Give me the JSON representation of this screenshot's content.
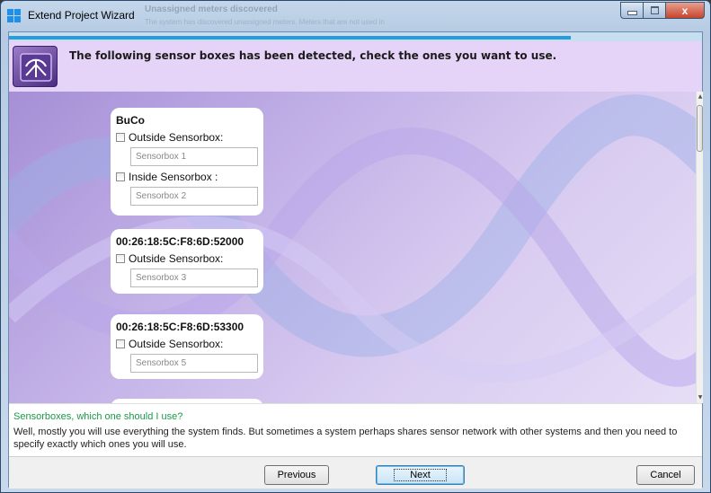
{
  "window": {
    "title": "Extend Project Wizard",
    "ghost_title": "Unassigned meters discovered",
    "ghost_subtitle": "The system has discovered unassigned meters. Meters that are not used in",
    "close_glyph": "x"
  },
  "progress": {
    "fraction": 0.81
  },
  "header": {
    "text": "The following sensor boxes has been detected, check the ones you want to use."
  },
  "devices": [
    {
      "name": "BuCo",
      "sensors": [
        {
          "label": "Outside Sensorbox:",
          "value": "Sensorbox 1",
          "checked": false
        },
        {
          "label": "Inside Sensorbox :",
          "value": "Sensorbox 2",
          "checked": false
        }
      ]
    },
    {
      "name": "00:26:18:5C:F8:6D:52000",
      "sensors": [
        {
          "label": "Outside Sensorbox:",
          "value": "Sensorbox 3",
          "checked": false
        }
      ]
    },
    {
      "name": "00:26:18:5C:F8:6D:53300",
      "sensors": [
        {
          "label": "Outside Sensorbox:",
          "value": "Sensorbox 5",
          "checked": false
        }
      ]
    }
  ],
  "help": {
    "title": "Sensorboxes, which one should I use?",
    "body": "Well, mostly you will use everything the system finds. But sometimes a system perhaps shares sensor network with other systems and then you need to specify exactly which ones you will use."
  },
  "buttons": {
    "previous": "Previous",
    "next": "Next",
    "cancel": "Cancel"
  },
  "colors": {
    "help_title": "#1a9a48",
    "progress": "#2f9bd6",
    "header_band": "#e6d4f8"
  }
}
